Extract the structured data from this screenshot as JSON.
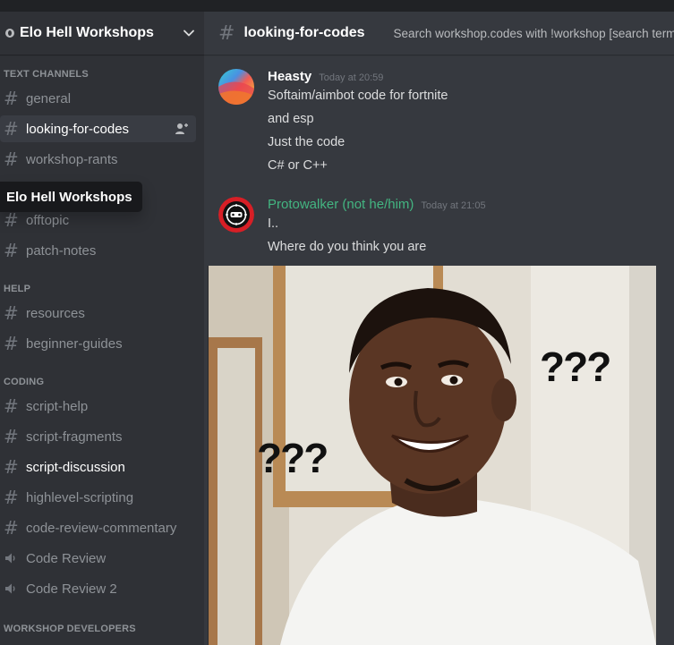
{
  "server": {
    "name": "Elo Hell Workshops"
  },
  "tooltip": {
    "text": "Elo Hell Workshops"
  },
  "categories": {
    "text": "TEXT CHANNELS",
    "help": "HELP",
    "coding": "CODING",
    "workshop_dev": "WORKSHOP DEVELOPERS"
  },
  "channels": {
    "general": "general",
    "looking_for_codes": "looking-for-codes",
    "workshop_rants": "workshop-rants",
    "offtopic": "offtopic",
    "patch_notes": "patch-notes",
    "resources": "resources",
    "beginner_guides": "beginner-guides",
    "script_help": "script-help",
    "script_fragments": "script-fragments",
    "script_discussion": "script-discussion",
    "highlevel_scripting": "highlevel-scripting",
    "code_review_commentary": "code-review-commentary",
    "code_review": "Code Review",
    "code_review_2": "Code Review 2"
  },
  "hash_glyph": "#",
  "header": {
    "channel": "looking-for-codes",
    "topic": "Search workshop.codes with !workshop [search terms]"
  },
  "messages": [
    {
      "author": "Heasty",
      "timestamp": "Today at 20:59",
      "lines": [
        "Softaim/aimbot code for fortnite",
        "and esp",
        "Just the code",
        "C# or C++"
      ]
    },
    {
      "author": "Protowalker (not he/him)",
      "author_color": "#43b581",
      "timestamp": "Today at 21:05",
      "lines": [
        "I..",
        "Where do you think you are"
      ]
    }
  ],
  "image": {
    "left_text": "???",
    "right_text": "???"
  },
  "icons": {
    "chevron": "chevron-down-icon",
    "invite": "add-member-icon",
    "speaker": "speaker-icon",
    "server": "server-badge-icon"
  }
}
